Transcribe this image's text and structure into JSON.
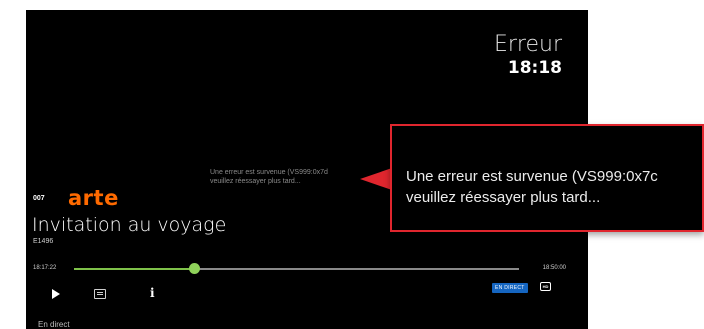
{
  "header": {
    "title": "Erreur",
    "clock": "18:18"
  },
  "error": {
    "line1": "Une erreur est survenue (VS999:0x7d",
    "line2": "veuillez réessayer plus tard..."
  },
  "channel": {
    "number": "007",
    "logo_text": "arte",
    "logo_color": "#ff6a00"
  },
  "program": {
    "title": "Invitation au voyage",
    "episode": "E1496"
  },
  "timeline": {
    "start": "18:17:22",
    "end": "18:50:00",
    "progress_fraction": 0.27,
    "fill_color": "#7fc24a"
  },
  "controls": {
    "play": "play-icon",
    "subtitles": "subtitles-icon",
    "info_label": "i",
    "live_badge": "EN DIRECT",
    "hd_label": "HD"
  },
  "status": {
    "text": "En direct"
  },
  "callout": {
    "line1": "Une erreur est survenue (VS999:0x7c",
    "line2": "veuillez réessayer plus tard...",
    "border_color": "#e0262e"
  }
}
